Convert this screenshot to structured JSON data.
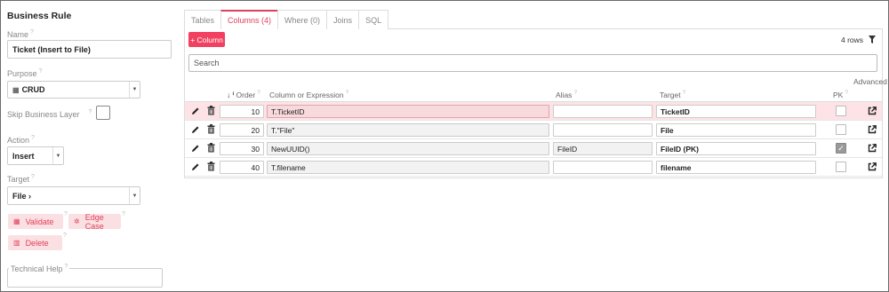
{
  "left": {
    "title": "Business Rule",
    "name_label": "Name",
    "name_value": "Ticket (Insert to File)",
    "purpose_label": "Purpose",
    "purpose_value": "CRUD",
    "skip_label": "Skip Business Layer",
    "action_label": "Action",
    "action_value": "Insert",
    "target_label": "Target",
    "target_value": "File ›",
    "validate_label": "Validate",
    "edge_case_label": "Edge Case",
    "delete_label": "Delete",
    "tech_help_label": "Technical Help"
  },
  "tabs": [
    {
      "label": "Tables"
    },
    {
      "label": "Columns (4)"
    },
    {
      "label": "Where (0)"
    },
    {
      "label": "Joins"
    },
    {
      "label": "SQL"
    }
  ],
  "toolbar": {
    "add_column_label": "+ Column",
    "rows_count": "4 rows",
    "search_placeholder": "Search"
  },
  "columns": {
    "order": "Order",
    "expression": "Column or Expression",
    "alias": "Alias",
    "target": "Target",
    "advanced": "Advanced",
    "pk": "PK"
  },
  "rows": [
    {
      "order": "10",
      "expression": "T.TicketID",
      "alias": "",
      "target": "TicketID",
      "pk": false
    },
    {
      "order": "20",
      "expression": "T.\"File\"",
      "alias": "",
      "target": "File",
      "pk": false
    },
    {
      "order": "30",
      "expression": "NewUUID()",
      "alias": "FileID",
      "target": "FileID (PK)",
      "pk": true
    },
    {
      "order": "40",
      "expression": "T.filename",
      "alias": "",
      "target": "filename",
      "pk": false
    }
  ],
  "colors": {
    "accent": "#e0405c",
    "accent_bg": "#fbe0e3",
    "selected_row": "#fde3e6"
  }
}
